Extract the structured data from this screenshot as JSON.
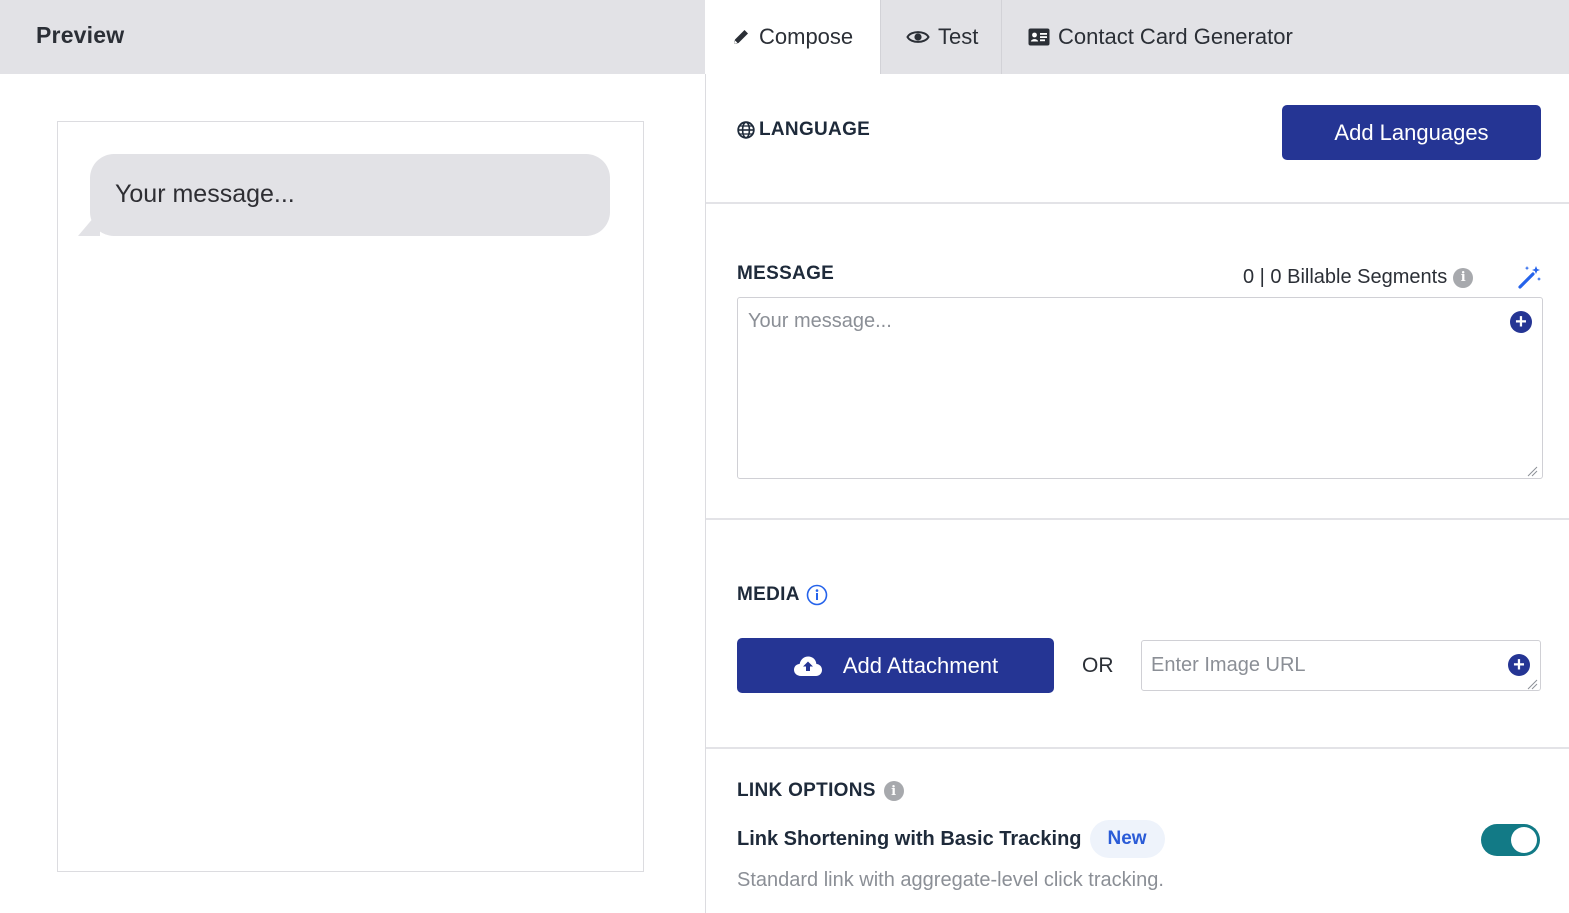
{
  "preview": {
    "title": "Preview",
    "bubble_text": "Your message..."
  },
  "tabs": [
    {
      "label": "Compose",
      "icon": "pencil-icon",
      "active": true
    },
    {
      "label": "Test",
      "icon": "eye-icon",
      "active": false
    },
    {
      "label": "Contact Card Generator",
      "icon": "contact-card-icon",
      "active": false
    }
  ],
  "language": {
    "label": "LANGUAGE",
    "icon": "globe-icon",
    "add_button": "Add Languages"
  },
  "message": {
    "label": "MESSAGE",
    "billable": "0 | 0 Billable Segments",
    "placeholder": "Your message...",
    "value": ""
  },
  "media": {
    "label": "MEDIA",
    "add_button": "Add Attachment",
    "or_text": "OR",
    "url_placeholder": "Enter Image URL"
  },
  "link_options": {
    "label": "LINK OPTIONS",
    "title": "Link Shortening with Basic Tracking",
    "badge": "New",
    "description": "Standard link with aggregate-level click tracking.",
    "enabled": true
  },
  "colors": {
    "primary": "#253594",
    "toggle_on": "#127a86",
    "header_gray": "#e2e2e6",
    "badge_text": "#2a5bd7"
  }
}
